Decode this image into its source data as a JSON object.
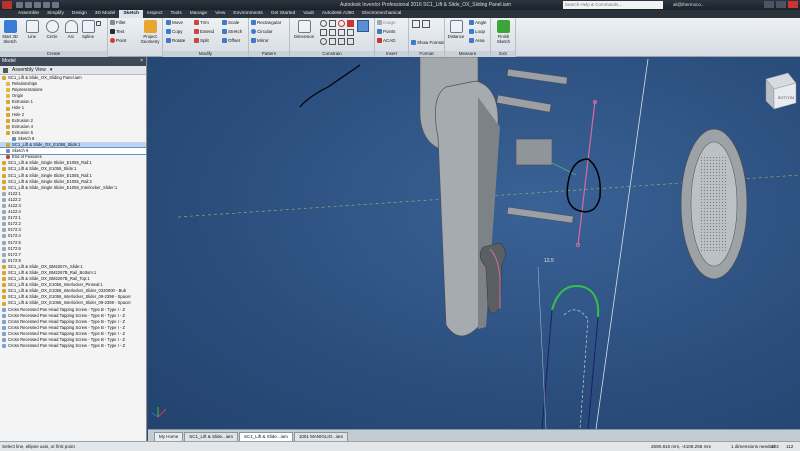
{
  "window": {
    "title": "Autodesk Inventor Professional 2016     SC1_Lift & Slide_OX_Sliding Panel.iam",
    "search_placeholder": "Search Help & Commands...",
    "user": "ali@thermoco..."
  },
  "ribbon_tabs": [
    "Assemble",
    "Simplify",
    "Design",
    "3D Model",
    "Sketch",
    "Inspect",
    "Tools",
    "Manage",
    "View",
    "Environments",
    "Get Started",
    "Vault",
    "Autodesk A360",
    "Electromechanical"
  ],
  "active_tab": "Sketch",
  "ribbon": {
    "sketch_group": {
      "title": "Sketch",
      "start_label": "Start 3D Sketch",
      "tools": [
        "Line",
        "Circle",
        "Arc",
        "Spline",
        "Rectangle",
        "Text",
        "Fillet",
        "Point"
      ],
      "project_label": "Project Geometry"
    },
    "create_group": {
      "title": "Create"
    },
    "modify_group": {
      "title": "Modify",
      "tools": [
        "Move",
        "Copy",
        "Rotate",
        "Trim",
        "Extend",
        "Split",
        "Scale",
        "Stretch",
        "Offset"
      ]
    },
    "pattern_group": {
      "title": "Pattern",
      "tools": [
        "Rectangular",
        "Circular",
        "Mirror"
      ]
    },
    "constrain_group": {
      "title": "Constrain",
      "dimension_label": "Dimension"
    },
    "insert_group": {
      "title": "Insert",
      "tools": [
        "Image",
        "Points",
        "ACAD"
      ]
    },
    "format_group": {
      "title": "Format",
      "tools": [
        "Show Format"
      ]
    },
    "measure_group": {
      "title": "Measure",
      "distance_label": "Distance",
      "tools": [
        "Angle",
        "Loop",
        "Area"
      ]
    },
    "exit_group": {
      "title": "Exit",
      "finish_label": "Finish Sketch"
    }
  },
  "browser": {
    "header": "Model",
    "close": "×",
    "view_label": "Assembly View",
    "items": [
      {
        "label": "SC1_Lift & Slide_OX_Sliding Panel.iam",
        "icon": "part-icon"
      },
      {
        "label": "Relationships",
        "icon": "folder-icon"
      },
      {
        "label": "Representations",
        "icon": "folder-icon"
      },
      {
        "label": "Origin",
        "icon": "folder-icon"
      },
      {
        "label": "Extrusion 1",
        "icon": "part-icon"
      },
      {
        "label": "Hole 1",
        "icon": "part-icon"
      },
      {
        "label": "Hole 2",
        "icon": "part-icon"
      },
      {
        "label": "Extrusion 2",
        "icon": "part-icon"
      },
      {
        "label": "Extrusion 4",
        "icon": "part-icon"
      },
      {
        "label": "Extrusion 5",
        "icon": "part-icon"
      },
      {
        "label": "Sketch 8",
        "icon": "sketch-icon"
      },
      {
        "label": "SC1_Lift & Slide_OX_E1056_Slide:1",
        "icon": "part-icon",
        "selected": true
      },
      {
        "label": "Sketch 9",
        "icon": "sketch-icon",
        "editing": true
      },
      {
        "label": "End of Features",
        "icon": "end-icon"
      },
      {
        "label": "SC1_Lift & Slide_Single Slider_E1055_Rail:1",
        "icon": "part-icon"
      },
      {
        "label": "SC1_Lift & Slide_OX_E1055_Slide:1",
        "icon": "part-icon"
      },
      {
        "label": "SC1_Lift & Slide_Single Slider_E1055_Rail:1",
        "icon": "part-icon"
      },
      {
        "label": "SC1_Lift & Slide_Single Slider_E1055_Rail:2",
        "icon": "part-icon"
      },
      {
        "label": "SC1_Lift & Slide_Single Slider_E1056_Interlocker_Slider:1",
        "icon": "part-icon"
      },
      {
        "label": "4122:1",
        "icon": "ref-icon"
      },
      {
        "label": "4122:2",
        "icon": "ref-icon"
      },
      {
        "label": "4122:3",
        "icon": "ref-icon"
      },
      {
        "label": "4122:4",
        "icon": "ref-icon"
      },
      {
        "label": "0172:1",
        "icon": "ref-icon"
      },
      {
        "label": "0172:2",
        "icon": "ref-icon"
      },
      {
        "label": "0172:3",
        "icon": "ref-icon"
      },
      {
        "label": "0172:4",
        "icon": "ref-icon"
      },
      {
        "label": "0172:5",
        "icon": "ref-icon"
      },
      {
        "label": "0172:6",
        "icon": "ref-icon"
      },
      {
        "label": "0172:7",
        "icon": "ref-icon"
      },
      {
        "label": "0172:8",
        "icon": "ref-icon"
      },
      {
        "label": "SC1_Lift & Slide_OX_BM2267A_Slide:1",
        "icon": "part-icon"
      },
      {
        "label": "SC1_Lift & Slide_OX_BM2267B_Rail_Bottom:1",
        "icon": "part-icon"
      },
      {
        "label": "SC1_Lift & Slide_OX_BM2267B_Rail_Top:1",
        "icon": "part-icon"
      },
      {
        "label": "SC1_Lift & Slide_OX_E1056_Interlocker_Pinseal:1",
        "icon": "part-icon"
      },
      {
        "label": "SC1_Lift & Slide_OX_E1056_Interlocker_Slider_0320000 - Bub",
        "icon": "part-icon"
      },
      {
        "label": "SC1_Lift & Slide_OX_E1056_Interlocker_Slider_09-2398 - Spacer",
        "icon": "part-icon"
      },
      {
        "label": "SC1_Lift & Slide_OX_E1056_Interlocker_Slider_09-2398 - Spacer",
        "icon": "part-icon"
      },
      {
        "label": "Cross Recessed Pan Head Tapping Screw - Type B - Type I - Z",
        "icon": "screw-icon"
      },
      {
        "label": "Cross Recessed Pan Head Tapping Screw - Type B - Type I - Z",
        "icon": "screw-icon"
      },
      {
        "label": "Cross Recessed Pan Head Tapping Screw - Type B - Type I - Z",
        "icon": "screw-icon"
      },
      {
        "label": "Cross Recessed Pan Head Tapping Screw - Type B - Type I - Z",
        "icon": "screw-icon"
      },
      {
        "label": "Cross Recessed Pan Head Tapping Screw - Type B - Type I - Z",
        "icon": "screw-icon"
      },
      {
        "label": "Cross Recessed Pan Head Tapping Screw - Type B - Type I - Z",
        "icon": "screw-icon"
      },
      {
        "label": "Cross Recessed Pan Head Tapping Screw - Type B - Type I - Z",
        "icon": "screw-icon"
      }
    ]
  },
  "viewport": {
    "dimension_label": "12.5",
    "viewcube_label": "BOTTOM"
  },
  "document_tabs": [
    "My Home",
    "SC1_Lift & Slide...iam",
    "SC1_Lift & Slide...iam",
    "1001 MANIGLIO...iam"
  ],
  "active_document_tab": 2,
  "statusbar": {
    "message": "Select line, ellipse axis, or first point",
    "coordinates": "2590.810 mm, -4108.255 mm",
    "dimensions": "1 dimensions needed",
    "count_a": "103",
    "count_b": "112"
  },
  "colors": {
    "viewport_bg": "#2b4f7a",
    "sketch_pink": "#d66b9a",
    "sketch_green": "#33c14a",
    "annotation_black": "#000000",
    "part_grey": "#9ea3a8"
  }
}
